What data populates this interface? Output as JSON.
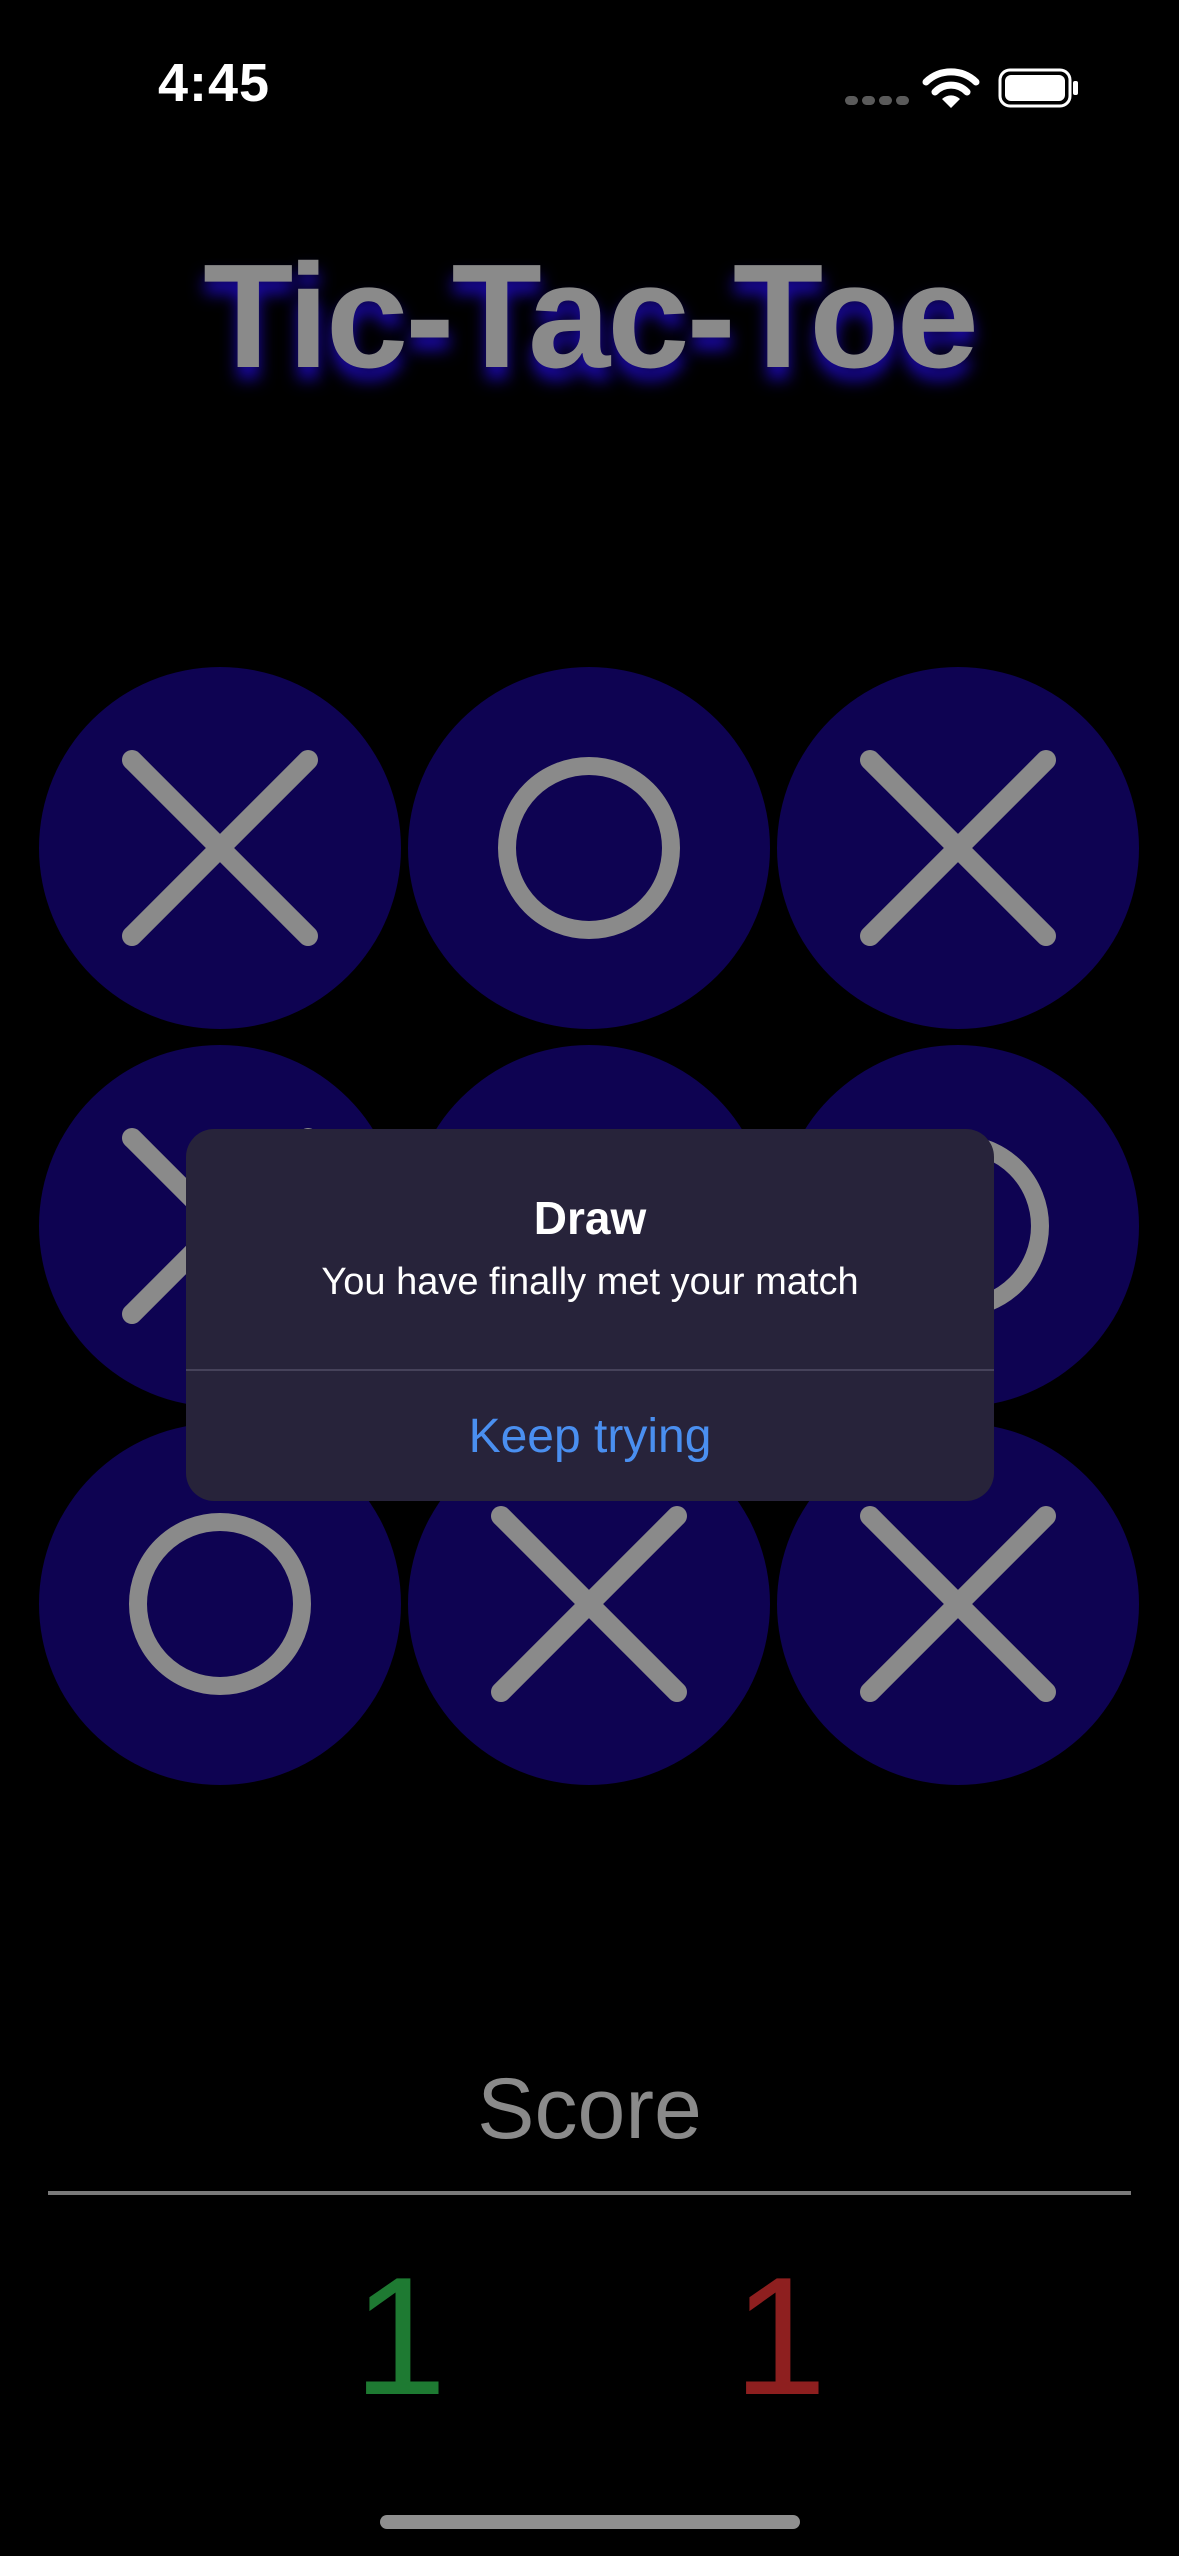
{
  "status_bar": {
    "time": "4:45",
    "icons": [
      "signal-icon",
      "wifi-icon",
      "battery-icon"
    ]
  },
  "title": "Tic-Tac-Toe",
  "board": {
    "cells": [
      "X",
      "O",
      "X",
      "X",
      "",
      "O",
      "O",
      "X",
      "X"
    ],
    "colors": {
      "cell_bg": "#0e0352",
      "mark": "#8a8a8a"
    }
  },
  "alert": {
    "title": "Draw",
    "message": "You have finally met your match",
    "action_label": "Keep trying"
  },
  "score": {
    "label": "Score",
    "player": "1",
    "opponent": "1",
    "colors": {
      "player": "#1e7a32",
      "opponent": "#8e1f1f"
    }
  }
}
